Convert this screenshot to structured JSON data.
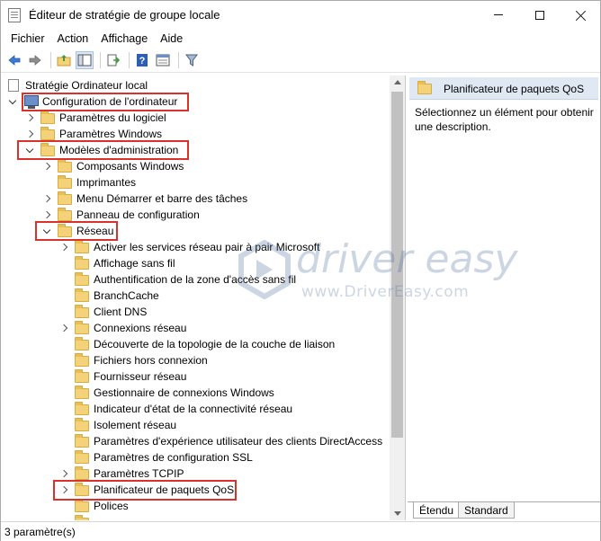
{
  "window": {
    "title": "Éditeur de stratégie de groupe locale",
    "controls": [
      "minimize",
      "maximize",
      "close"
    ]
  },
  "menu": [
    "Fichier",
    "Action",
    "Affichage",
    "Aide"
  ],
  "toolbar": {
    "icons": [
      "back-arrow-icon",
      "forward-arrow-icon",
      "up-folder-icon",
      "show-hide-tree-icon",
      "export-list-icon",
      "help-icon",
      "properties-icon",
      "filter-icon"
    ]
  },
  "tree": {
    "items": [
      {
        "label": "Stratégie Ordinateur local",
        "icon": "document-icon",
        "expander": "none",
        "highlight": false
      },
      {
        "label": "Configuration de l'ordinateur",
        "icon": "computer-icon",
        "expander": "down",
        "highlight": true
      },
      {
        "label": "Paramètres du logiciel",
        "icon": "folder-icon",
        "expander": "right",
        "highlight": false
      },
      {
        "label": "Paramètres Windows",
        "icon": "folder-icon",
        "expander": "right",
        "highlight": false
      },
      {
        "label": "Modèles d'administration",
        "icon": "folder-icon",
        "expander": "down",
        "highlight": true
      },
      {
        "label": "Composants Windows",
        "icon": "folder-icon",
        "expander": "right",
        "highlight": false
      },
      {
        "label": "Imprimantes",
        "icon": "folder-icon",
        "expander": "none",
        "highlight": false
      },
      {
        "label": "Menu Démarrer et barre des tâches",
        "icon": "folder-icon",
        "expander": "right",
        "highlight": false
      },
      {
        "label": "Panneau de configuration",
        "icon": "folder-icon",
        "expander": "right",
        "highlight": false
      },
      {
        "label": "Réseau",
        "icon": "folder-icon",
        "expander": "down",
        "highlight": true
      },
      {
        "label": "Activer les services réseau pair à pair Microsoft",
        "icon": "folder-icon",
        "expander": "right",
        "highlight": false
      },
      {
        "label": "Affichage sans fil",
        "icon": "folder-icon",
        "expander": "none",
        "highlight": false
      },
      {
        "label": "Authentification de la zone d'accès sans fil",
        "icon": "folder-icon",
        "expander": "none",
        "highlight": false
      },
      {
        "label": "BranchCache",
        "icon": "folder-icon",
        "expander": "none",
        "highlight": false
      },
      {
        "label": "Client DNS",
        "icon": "folder-icon",
        "expander": "none",
        "highlight": false
      },
      {
        "label": "Connexions réseau",
        "icon": "folder-icon",
        "expander": "right",
        "highlight": false
      },
      {
        "label": "Découverte de la topologie de la couche de liaison",
        "icon": "folder-icon",
        "expander": "none",
        "highlight": false
      },
      {
        "label": "Fichiers hors connexion",
        "icon": "folder-icon",
        "expander": "none",
        "highlight": false
      },
      {
        "label": "Fournisseur réseau",
        "icon": "folder-icon",
        "expander": "none",
        "highlight": false
      },
      {
        "label": "Gestionnaire de connexions Windows",
        "icon": "folder-icon",
        "expander": "none",
        "highlight": false
      },
      {
        "label": "Indicateur d'état de la connectivité réseau",
        "icon": "folder-icon",
        "expander": "none",
        "highlight": false
      },
      {
        "label": "Isolement réseau",
        "icon": "folder-icon",
        "expander": "none",
        "highlight": false
      },
      {
        "label": "Paramètres d'expérience utilisateur des clients DirectAccess",
        "icon": "folder-icon",
        "expander": "none",
        "highlight": false
      },
      {
        "label": "Paramètres de configuration SSL",
        "icon": "folder-icon",
        "expander": "none",
        "highlight": false
      },
      {
        "label": "Paramètres TCPIP",
        "icon": "folder-icon",
        "expander": "right",
        "highlight": false
      },
      {
        "label": "Planificateur de paquets QoS",
        "icon": "folder-icon",
        "expander": "right",
        "highlight": true
      },
      {
        "label": "Polices",
        "icon": "folder-icon",
        "expander": "none",
        "highlight": false
      }
    ]
  },
  "details": {
    "header": "Planificateur de paquets QoS",
    "description": "Sélectionnez un élément pour obtenir une description.",
    "tabs": [
      "Étendu",
      "Standard"
    ],
    "active_tab": "Étendu"
  },
  "status": "3 paramètre(s)",
  "watermark": {
    "title": "driver easy",
    "url": "www.DriverEasy.com"
  },
  "colors": {
    "highlight_box": "#d9312b",
    "header_bg": "#dfe8f3",
    "folder": "#f3d27a"
  }
}
